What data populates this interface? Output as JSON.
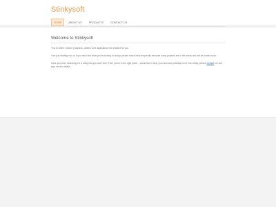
{
  "site": {
    "logo": "Stinkysoft"
  },
  "nav": {
    "items": [
      {
        "label": "HOME"
      },
      {
        "label": "ABOUT US"
      },
      {
        "label": "PRODUCTS"
      },
      {
        "label": "CONTACT US"
      }
    ],
    "active_index": 0
  },
  "main": {
    "heading": "Welcome to Stinkysoft",
    "p1": "This is where custom programs, utilities, and applications are created for you.",
    "p2": "I am just starting out, so if you don't find what you're looking for today, please check back frequently because many projects are in the works and will be posted soon.",
    "p3_before": "Have you been searching for a utility that you can't find? Then you're in the right place. I would like to hear your idea and possibly turn it into reality, please",
    "p3_link": "contact",
    "p3_after": "me and give me the details."
  },
  "colors": {
    "accent": "#e89a4c",
    "link": "#3a67c9"
  }
}
